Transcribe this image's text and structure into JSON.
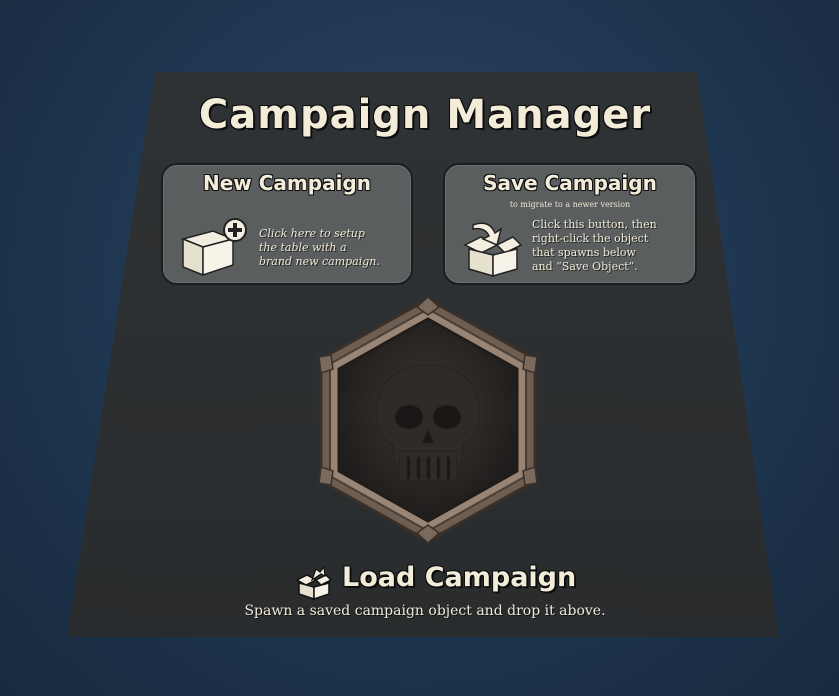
{
  "title": "Campaign Manager",
  "new_campaign": {
    "title": "New Campaign",
    "description_lines": [
      "Click here to setup",
      "the table with a",
      "brand new campaign."
    ],
    "icon": "box-plus-icon"
  },
  "save_campaign": {
    "title": "Save Campaign",
    "subtitle": "to migrate to a newer version",
    "description_lines": [
      "Click this button, then",
      "right-click the object",
      "that spawns below",
      "and “Save Object”."
    ],
    "icon": "box-arrow-in-icon"
  },
  "drop_zone": {
    "icon": "skull-icon"
  },
  "load_campaign": {
    "title": "Load Campaign",
    "description": "Spawn a saved campaign object and drop it above.",
    "icon": "box-open-icon"
  },
  "colors": {
    "board": "#2c2f31",
    "card": "#5a5e5f",
    "text": "#f2ecd9",
    "table_bg": "#1f3650",
    "frame": "#8a7462"
  }
}
